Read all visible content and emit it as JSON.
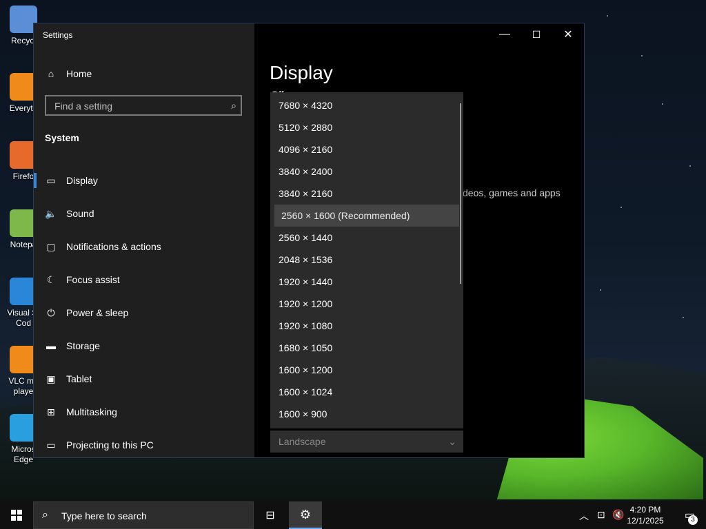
{
  "desktop": {
    "icons": [
      {
        "label": "Recycl",
        "icon": "recycle-bin-icon"
      },
      {
        "label": "Everyth",
        "icon": "everything-search-icon"
      },
      {
        "label": "Firefo",
        "icon": "firefox-icon"
      },
      {
        "label": "Notepa",
        "icon": "notepad-icon"
      },
      {
        "label": "Visual St Cod",
        "icon": "vscode-icon"
      },
      {
        "label": "VLC me playe",
        "icon": "vlc-icon"
      },
      {
        "label": "Micros Edge",
        "icon": "edge-icon"
      }
    ]
  },
  "window": {
    "title": "Settings",
    "controls": {
      "minimize": "—",
      "maximize": "☐",
      "close": "✕"
    }
  },
  "sidebar": {
    "home_label": "Home",
    "search_placeholder": "Find a setting",
    "section": "System",
    "items": [
      {
        "label": "Display",
        "icon": "monitor-icon",
        "glyph": "▭"
      },
      {
        "label": "Sound",
        "icon": "speaker-icon",
        "glyph": "🔈"
      },
      {
        "label": "Notifications & actions",
        "icon": "notification-icon",
        "glyph": "▢"
      },
      {
        "label": "Focus assist",
        "icon": "moon-icon",
        "glyph": "☾"
      },
      {
        "label": "Power & sleep",
        "icon": "power-icon",
        "glyph": "⏻"
      },
      {
        "label": "Storage",
        "icon": "storage-icon",
        "glyph": "▬"
      },
      {
        "label": "Tablet",
        "icon": "tablet-icon",
        "glyph": "▣"
      },
      {
        "label": "Multitasking",
        "icon": "multitasking-icon",
        "glyph": "⊞"
      },
      {
        "label": "Projecting to this PC",
        "icon": "projecting-icon",
        "glyph": "▭"
      }
    ]
  },
  "content": {
    "page_title": "Display",
    "toggle_state": "Off",
    "partial_text": "deos, games and apps",
    "partial_s": "s"
  },
  "resolution_dropdown": {
    "options": [
      "7680 × 4320",
      "5120 × 2880",
      "4096 × 2160",
      "3840 × 2400",
      "3840 × 2160",
      "2560 × 1600 (Recommended)",
      "2560 × 1440",
      "2048 × 1536",
      "1920 × 1440",
      "1920 × 1200",
      "1920 × 1080",
      "1680 × 1050",
      "1600 × 1200",
      "1600 × 1024",
      "1600 × 900"
    ],
    "selected_index": 5
  },
  "orientation": {
    "value": "Landscape"
  },
  "taskbar": {
    "search_placeholder": "Type here to search",
    "time": "4:20 PM",
    "date": "12/1/2025",
    "notification_count": "3"
  }
}
